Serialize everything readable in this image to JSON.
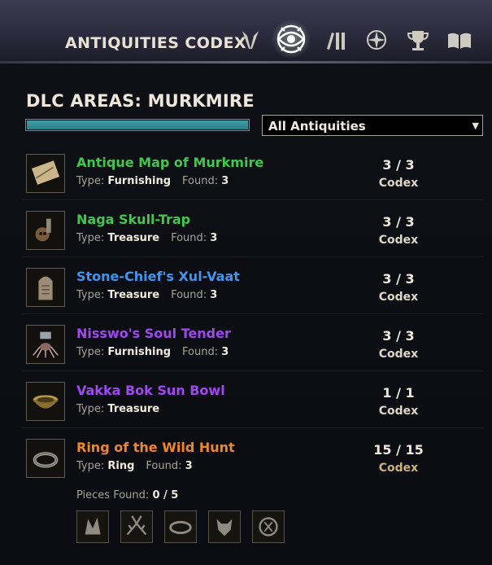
{
  "header": {
    "title": "ANTIQUITIES CODEX",
    "tabs": [
      {
        "icon": "antiquity-scepter-icon",
        "active": false
      },
      {
        "icon": "codex-eye-icon",
        "active": true
      },
      {
        "icon": "books-icon",
        "active": false
      },
      {
        "icon": "compass-star-icon",
        "active": false
      },
      {
        "icon": "trophy-icon",
        "active": false
      },
      {
        "icon": "open-book-icon",
        "active": false
      }
    ]
  },
  "area": {
    "title": "DLC AREAS: MURKMIRE",
    "progress": 1.0
  },
  "filter": {
    "selected": "All Antiquities",
    "arrow": "▼"
  },
  "labels": {
    "type": "Type:",
    "found": "Found:",
    "pieces_found": "Pieces Found:"
  },
  "items": [
    {
      "name": "Antique Map of Murkmire",
      "color": "#3fc84a",
      "type": "Furnishing",
      "found": "3",
      "count": "3 / 3",
      "codex": "Codex",
      "icon": "map-scroll-icon"
    },
    {
      "name": "Naga Skull-Trap",
      "color": "#3fc84a",
      "type": "Treasure",
      "found": "3",
      "count": "3 / 3",
      "codex": "Codex",
      "icon": "skull-trap-icon"
    },
    {
      "name": "Stone-Chief's Xul-Vaat",
      "color": "#3f95f0",
      "type": "Treasure",
      "found": "3",
      "count": "3 / 3",
      "codex": "Codex",
      "icon": "stone-tablet-icon"
    },
    {
      "name": "Nisswo's Soul Tender",
      "color": "#a048f0",
      "type": "Furnishing",
      "found": "3",
      "count": "3 / 3",
      "codex": "Codex",
      "icon": "soul-tender-icon"
    },
    {
      "name": "Vakka Bok Sun Bowl",
      "color": "#a048f0",
      "type": "Treasure",
      "found": "",
      "count": "1 / 1",
      "codex": "Codex",
      "icon": "sun-bowl-icon"
    },
    {
      "name": "Ring of the Wild Hunt",
      "color": "#f0862a",
      "type": "Ring",
      "found": "3",
      "count": "15 / 15",
      "codex": "Codex",
      "icon": "ring-icon"
    }
  ],
  "pieces": {
    "found": "0 / 5",
    "icons": [
      "wolf-claw-fragment-icon",
      "antler-fragment-icon",
      "band-fragment-icon",
      "wolf-head-fragment-icon",
      "rune-fragment-icon"
    ]
  },
  "colors": {
    "accent_teal": "#2a8a94",
    "rare_green": "#3fc84a",
    "rare_blue": "#3f95f0",
    "rare_purple": "#a048f0",
    "rare_orange": "#f0862a"
  }
}
